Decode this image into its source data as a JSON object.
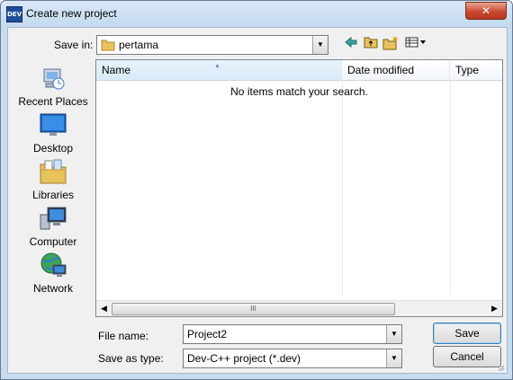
{
  "window": {
    "title": "Create new project",
    "app_icon_text": "DEV"
  },
  "close_glyph": "✕",
  "save_in": {
    "label": "Save in:",
    "value": "pertama",
    "icons": [
      "back-arrow-icon",
      "up-folder-icon",
      "new-folder-icon",
      "view-menu-icon"
    ]
  },
  "places": [
    {
      "label": "Recent Places",
      "icon": "recent-places-icon"
    },
    {
      "label": "Desktop",
      "icon": "desktop-icon"
    },
    {
      "label": "Libraries",
      "icon": "libraries-icon"
    },
    {
      "label": "Computer",
      "icon": "computer-icon"
    },
    {
      "label": "Network",
      "icon": "network-icon"
    }
  ],
  "list": {
    "columns": [
      "Name",
      "Date modified",
      "Type"
    ],
    "empty_message": "No items match your search.",
    "scroll_thumb_grip": "III"
  },
  "file_name": {
    "label": "File name:",
    "value": "Project2"
  },
  "save_as_type": {
    "label": "Save as type:",
    "value": "Dev-C++ project (*.dev)"
  },
  "buttons": {
    "save": "Save",
    "cancel": "Cancel"
  },
  "colors": {
    "title_bg": "#c4daf0",
    "close_red": "#c8452d",
    "folder_yellow": "#e8c25a",
    "header_highlight": "#d9ebf9"
  }
}
